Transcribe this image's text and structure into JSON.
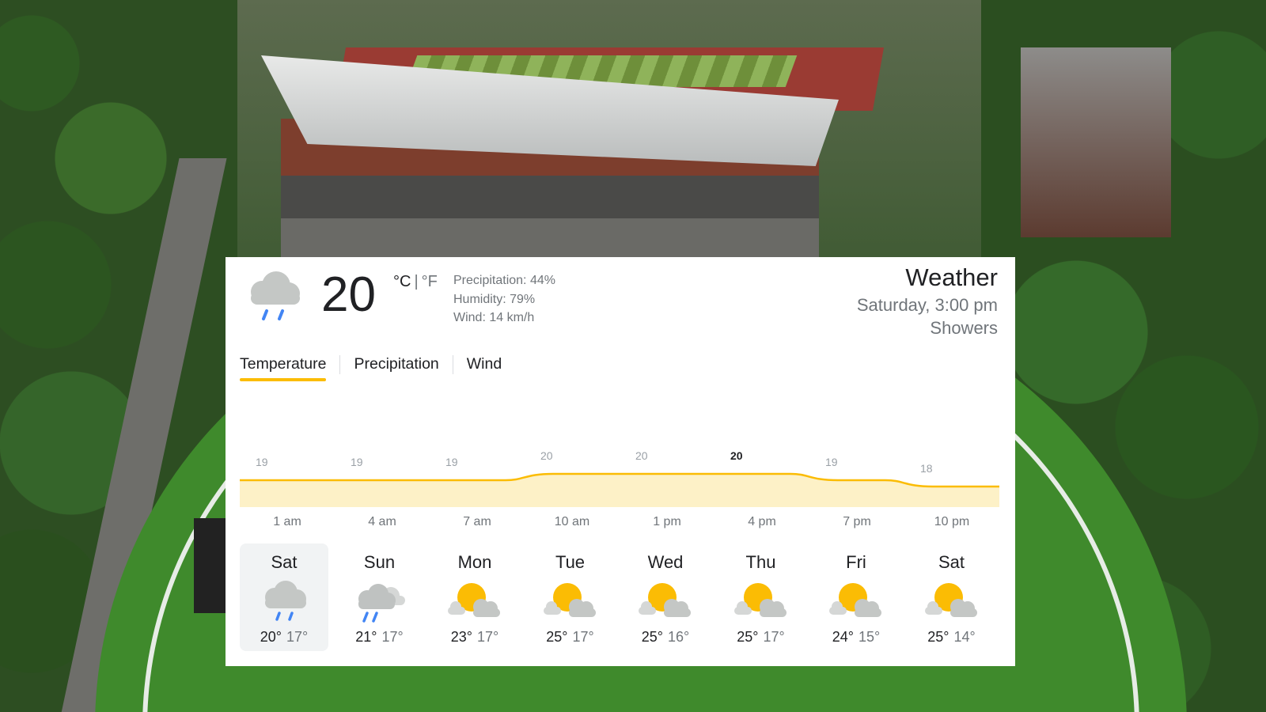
{
  "current": {
    "temperature": "20",
    "unit_c": "°C",
    "unit_separator": "|",
    "unit_f": "°F",
    "precipitation": "Precipitation: 44%",
    "humidity": "Humidity: 79%",
    "wind": "Wind: 14 km/h",
    "icon": "showers-icon"
  },
  "header": {
    "title": "Weather",
    "datetime": "Saturday, 3:00 pm",
    "condition": "Showers"
  },
  "tabs": [
    "Temperature",
    "Precipitation",
    "Wind"
  ],
  "chart_data": {
    "type": "area",
    "x": [
      "1 am",
      "4 am",
      "7 am",
      "10 am",
      "1 pm",
      "4 pm",
      "7 pm",
      "10 pm"
    ],
    "values": [
      19,
      19,
      19,
      20,
      20,
      20,
      19,
      18
    ],
    "value_labels": [
      "19",
      "19",
      "19",
      "20",
      "20",
      "20",
      "19",
      "18"
    ],
    "highlight_index": 5,
    "line_color": "#fbbc04",
    "fill_color": "#fdf1c7"
  },
  "forecast": [
    {
      "day": "Sat",
      "icon": "showers-icon",
      "high": "20°",
      "low": "17°"
    },
    {
      "day": "Sun",
      "icon": "cloudy-rain-icon",
      "high": "21°",
      "low": "17°"
    },
    {
      "day": "Mon",
      "icon": "partly-cloudy-icon",
      "high": "23°",
      "low": "17°"
    },
    {
      "day": "Tue",
      "icon": "partly-cloudy-icon",
      "high": "25°",
      "low": "17°"
    },
    {
      "day": "Wed",
      "icon": "partly-cloudy-icon",
      "high": "25°",
      "low": "16°"
    },
    {
      "day": "Thu",
      "icon": "partly-cloudy-icon",
      "high": "25°",
      "low": "17°"
    },
    {
      "day": "Fri",
      "icon": "partly-cloudy-icon",
      "high": "24°",
      "low": "15°"
    },
    {
      "day": "Sat",
      "icon": "partly-cloudy-icon",
      "high": "25°",
      "low": "14°"
    }
  ],
  "colors": {
    "accent": "#fbbc04",
    "text_primary": "#202124",
    "text_secondary": "#70757a",
    "sun": "#fbbc04",
    "cloud": "#c4c7c5",
    "rain": "#4285f4"
  }
}
